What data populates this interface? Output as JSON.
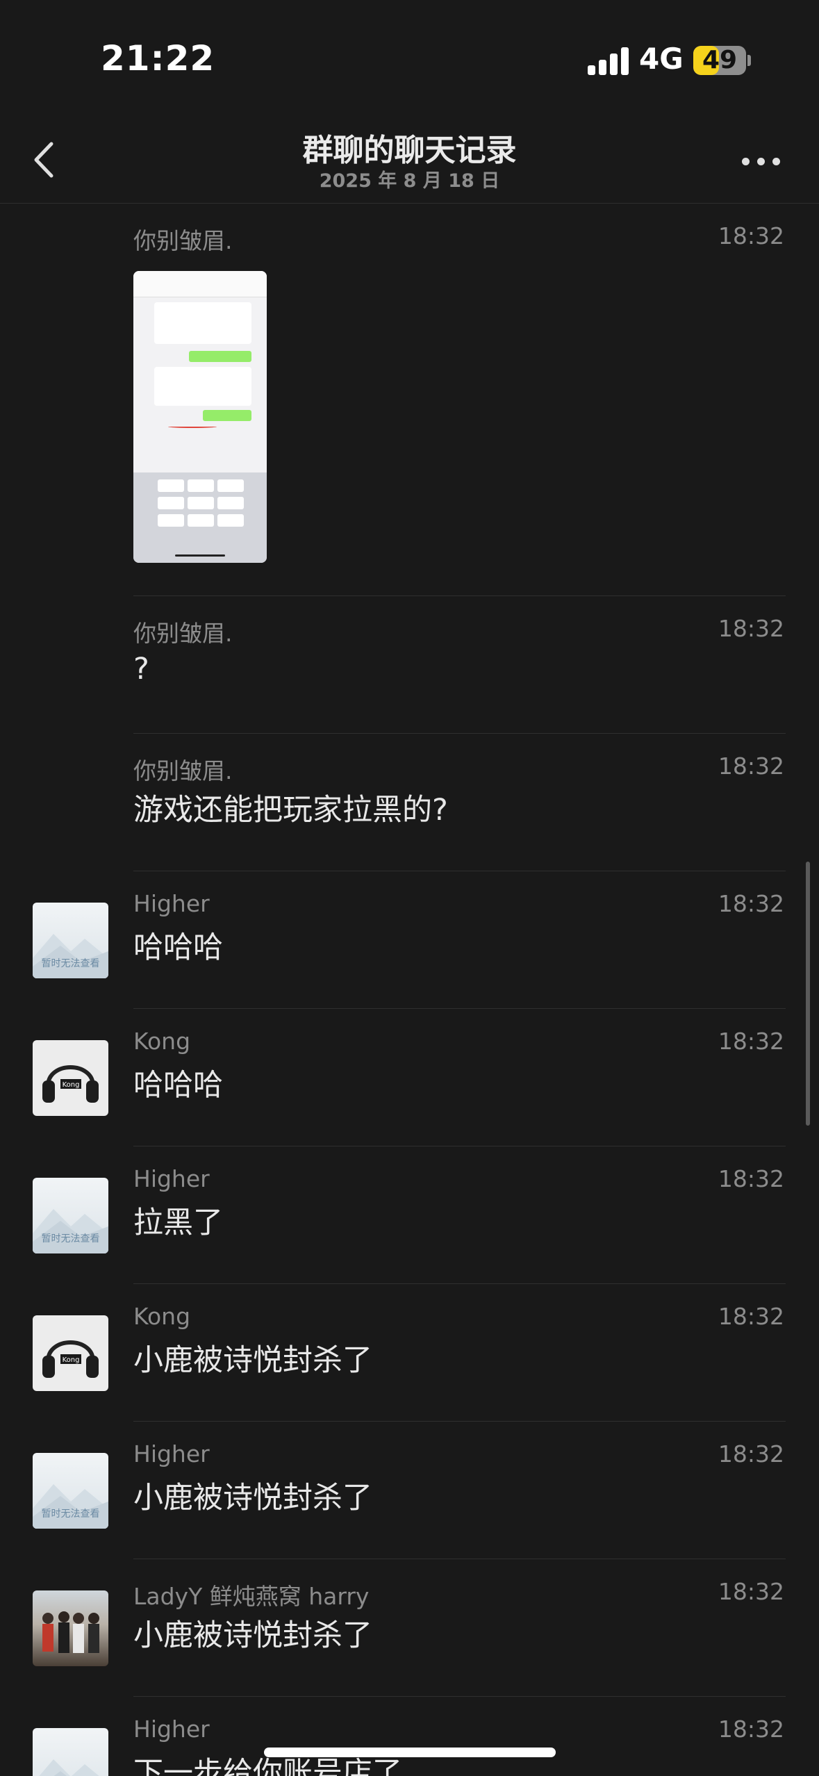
{
  "status_bar": {
    "time": "21:22",
    "network": "4G",
    "battery": "49",
    "battery_level": 0.49
  },
  "nav": {
    "title": "群聊的聊天记录",
    "subtitle": "2025 年 8 月 18 日"
  },
  "messages": [
    {
      "sender": "你别皱眉.",
      "time": "18:32",
      "type": "image",
      "avatar": "none",
      "content": ""
    },
    {
      "sender": "你别皱眉.",
      "time": "18:32",
      "type": "text",
      "avatar": "none",
      "content": "?"
    },
    {
      "sender": "你别皱眉.",
      "time": "18:32",
      "type": "text",
      "avatar": "none",
      "content": "游戏还能把玩家拉黑的?"
    },
    {
      "sender": "Higher",
      "time": "18:32",
      "type": "text",
      "avatar": "placeholder",
      "content": "哈哈哈"
    },
    {
      "sender": "Kong",
      "time": "18:32",
      "type": "text",
      "avatar": "headphones",
      "content": "哈哈哈"
    },
    {
      "sender": "Higher",
      "time": "18:32",
      "type": "text",
      "avatar": "placeholder",
      "content": "拉黑了"
    },
    {
      "sender": "Kong",
      "time": "18:32",
      "type": "text",
      "avatar": "headphones",
      "content": "小鹿被诗悦封杀了"
    },
    {
      "sender": "Higher",
      "time": "18:32",
      "type": "text",
      "avatar": "placeholder",
      "content": "小鹿被诗悦封杀了"
    },
    {
      "sender": "LadyY 鲜炖燕窝 harry",
      "time": "18:32",
      "type": "text",
      "avatar": "photo",
      "content": "小鹿被诗悦封杀了"
    },
    {
      "sender": "Higher",
      "time": "18:32",
      "type": "text",
      "avatar": "placeholder",
      "content": "下一步给你账号店了"
    }
  ],
  "placeholder_avatar_text": "暂时无法查看",
  "icons": {
    "back": "chevron-left-icon",
    "more": "ellipsis-icon",
    "signal": "signal-bars-icon",
    "battery": "battery-icon"
  }
}
